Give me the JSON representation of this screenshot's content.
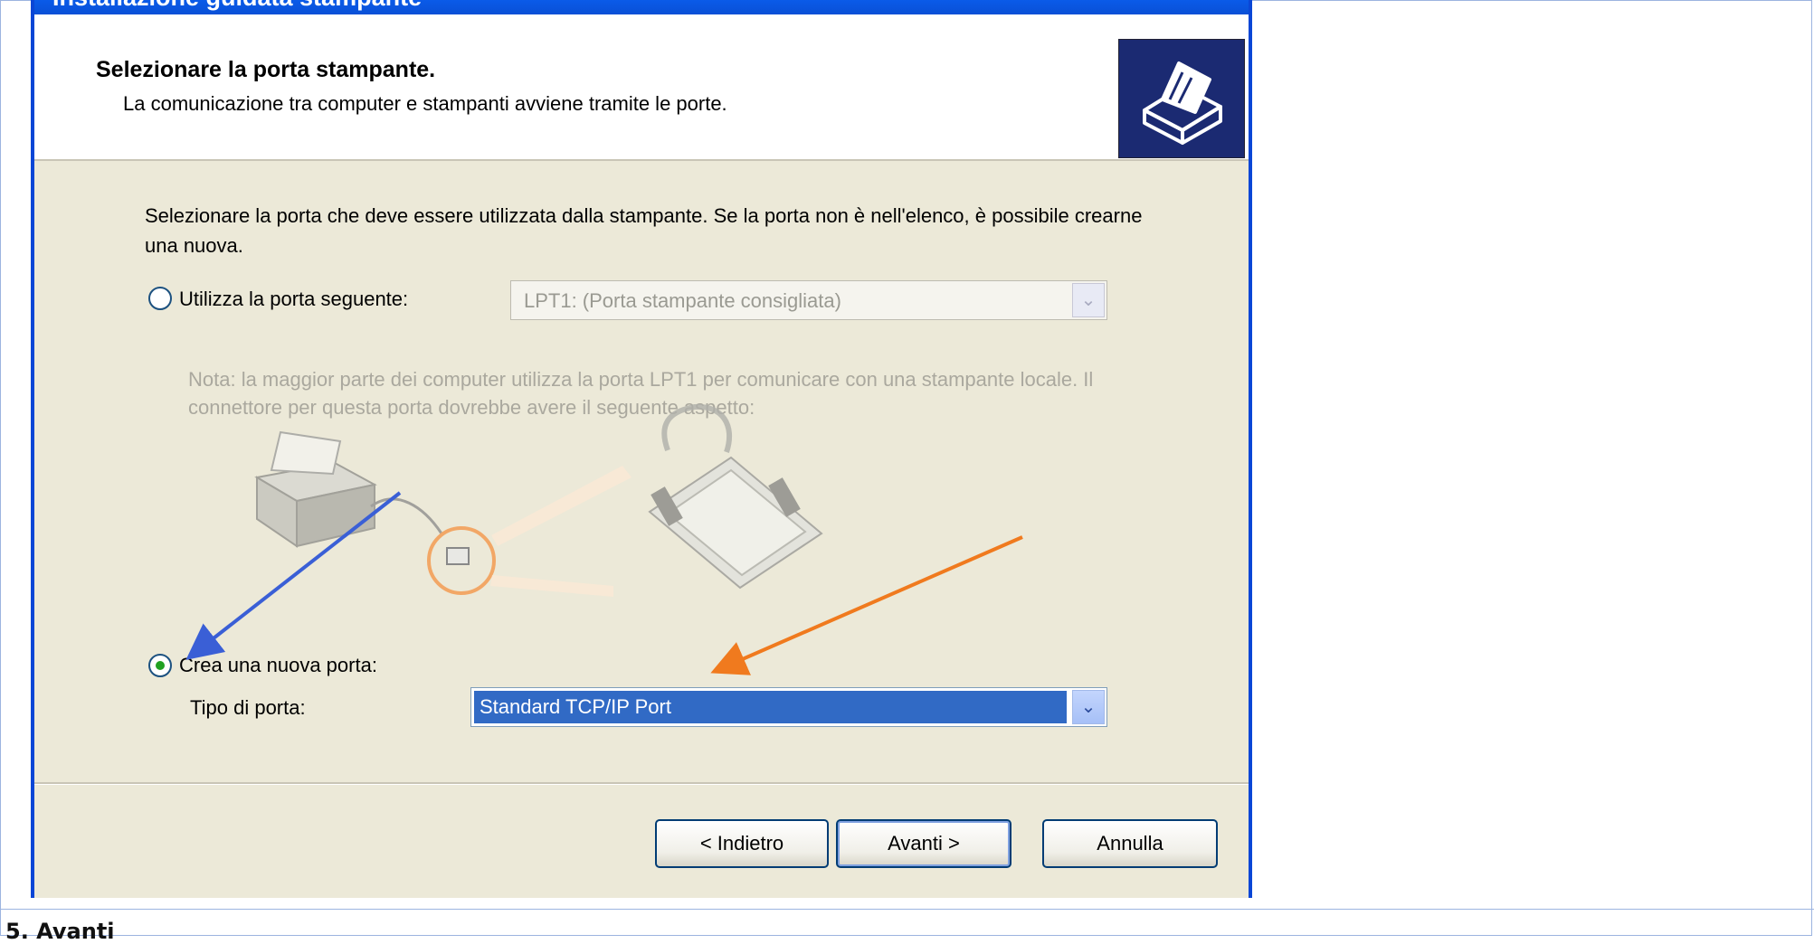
{
  "window": {
    "title": "Installazione guidata stampante"
  },
  "header": {
    "title": "Selezionare la porta stampante.",
    "subtitle": "La comunicazione tra computer e stampanti avviene tramite le porte.",
    "icon": "printer-icon"
  },
  "content": {
    "intro": "Selezionare la porta che deve essere utilizzata dalla stampante. Se la porta non è nell'elenco, è possibile crearne una nuova.",
    "existing_port": {
      "label": "Utilizza la porta seguente:",
      "selected": false,
      "value": "LPT1: (Porta stampante consigliata)",
      "enabled": false
    },
    "note": "Nota: la maggior parte dei computer utilizza la porta LPT1 per comunicare con una stampante locale. Il connettore per questa porta dovrebbe avere il seguente aspetto:",
    "new_port": {
      "label": "Crea una nuova porta:",
      "selected": true,
      "type_label": "Tipo di porta:",
      "type_value": "Standard TCP/IP Port"
    }
  },
  "buttons": {
    "back": "< Indietro",
    "next": "Avanti >",
    "cancel": "Annulla"
  },
  "caption": "5. Avanti",
  "annotations": {
    "blue_arrow_color": "#3a5fd6",
    "orange_arrow_color": "#f07a1e"
  }
}
